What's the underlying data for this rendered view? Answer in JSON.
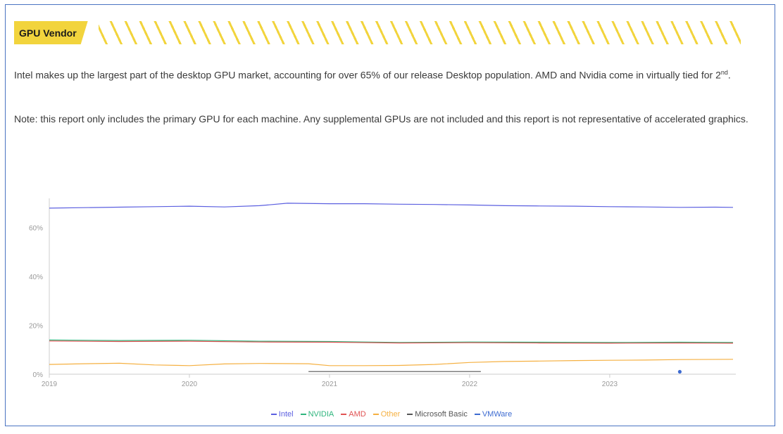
{
  "section": {
    "title": "GPU Vendor",
    "paragraph1_pre": "Intel makes up the largest part of the desktop GPU market, accounting for over 65% of our release Desktop population. AMD and Nvidia come in virtually tied for 2",
    "paragraph1_sup": "nd",
    "paragraph1_post": ".",
    "paragraph2": "Note: this report only includes the primary GPU for each machine. Any supplemental GPUs are not included and this report is not representative of accelerated graphics."
  },
  "colors": {
    "accent_yellow": "#f2d43d",
    "frame_border": "#4a74c2"
  },
  "chart_data": {
    "type": "line",
    "title": "",
    "xlabel": "",
    "ylabel": "",
    "xlim": [
      2019.0,
      2023.9
    ],
    "ylim": [
      0,
      72
    ],
    "yticks": [
      {
        "value": 0,
        "label": "0%"
      },
      {
        "value": 20,
        "label": "20%"
      },
      {
        "value": 40,
        "label": "40%"
      },
      {
        "value": 60,
        "label": "60%"
      }
    ],
    "xticks": [
      {
        "value": 2019,
        "label": "2019"
      },
      {
        "value": 2020,
        "label": "2020"
      },
      {
        "value": 2021,
        "label": "2021"
      },
      {
        "value": 2022,
        "label": "2022"
      },
      {
        "value": 2023,
        "label": "2023"
      }
    ],
    "grid": false,
    "legend_position": "bottom-center",
    "series": [
      {
        "name": "Intel",
        "color": "#5b5fe0",
        "x": [
          2019.0,
          2019.25,
          2019.5,
          2019.75,
          2020.0,
          2020.25,
          2020.5,
          2020.7,
          2021.0,
          2021.25,
          2021.5,
          2021.75,
          2022.0,
          2022.25,
          2022.5,
          2022.75,
          2023.0,
          2023.25,
          2023.5,
          2023.75,
          2023.88
        ],
        "y": [
          68.0,
          68.2,
          68.4,
          68.6,
          68.8,
          68.5,
          69.0,
          70.0,
          69.8,
          69.8,
          69.6,
          69.5,
          69.3,
          69.0,
          68.9,
          68.8,
          68.6,
          68.5,
          68.3,
          68.4,
          68.3
        ]
      },
      {
        "name": "NVIDIA",
        "color": "#2fb57d",
        "x": [
          2019.0,
          2019.5,
          2020.0,
          2020.5,
          2021.0,
          2021.5,
          2022.0,
          2022.5,
          2023.0,
          2023.5,
          2023.88
        ],
        "y": [
          14.0,
          13.8,
          13.9,
          13.5,
          13.4,
          13.0,
          13.2,
          13.1,
          13.0,
          13.1,
          13.0
        ]
      },
      {
        "name": "AMD",
        "color": "#e05252",
        "x": [
          2019.0,
          2019.5,
          2020.0,
          2020.5,
          2021.0,
          2021.5,
          2022.0,
          2022.5,
          2023.0,
          2023.5,
          2023.88
        ],
        "y": [
          13.6,
          13.4,
          13.5,
          13.2,
          13.1,
          12.8,
          12.9,
          12.8,
          12.7,
          12.8,
          12.7
        ]
      },
      {
        "name": "Other",
        "color": "#f5b041",
        "x": [
          2019.0,
          2019.25,
          2019.5,
          2019.75,
          2020.0,
          2020.25,
          2020.5,
          2020.85,
          2021.0,
          2021.25,
          2021.5,
          2021.75,
          2022.0,
          2022.25,
          2022.5,
          2022.75,
          2023.0,
          2023.25,
          2023.5,
          2023.88
        ],
        "y": [
          4.0,
          4.3,
          4.5,
          3.8,
          3.5,
          4.2,
          4.4,
          4.3,
          3.5,
          3.5,
          3.6,
          4.0,
          4.8,
          5.2,
          5.4,
          5.6,
          5.7,
          5.8,
          6.0,
          6.1
        ]
      },
      {
        "name": "Microsoft Basic",
        "color": "#555555",
        "x": [
          2020.85,
          2021.1,
          2021.4,
          2021.7,
          2022.08
        ],
        "y": [
          1.1,
          1.1,
          1.1,
          1.1,
          1.1
        ]
      },
      {
        "name": "VMWare",
        "color": "#3d6bd1",
        "x": [
          2023.5
        ],
        "y": [
          1.0
        ],
        "marker": "point"
      }
    ]
  }
}
